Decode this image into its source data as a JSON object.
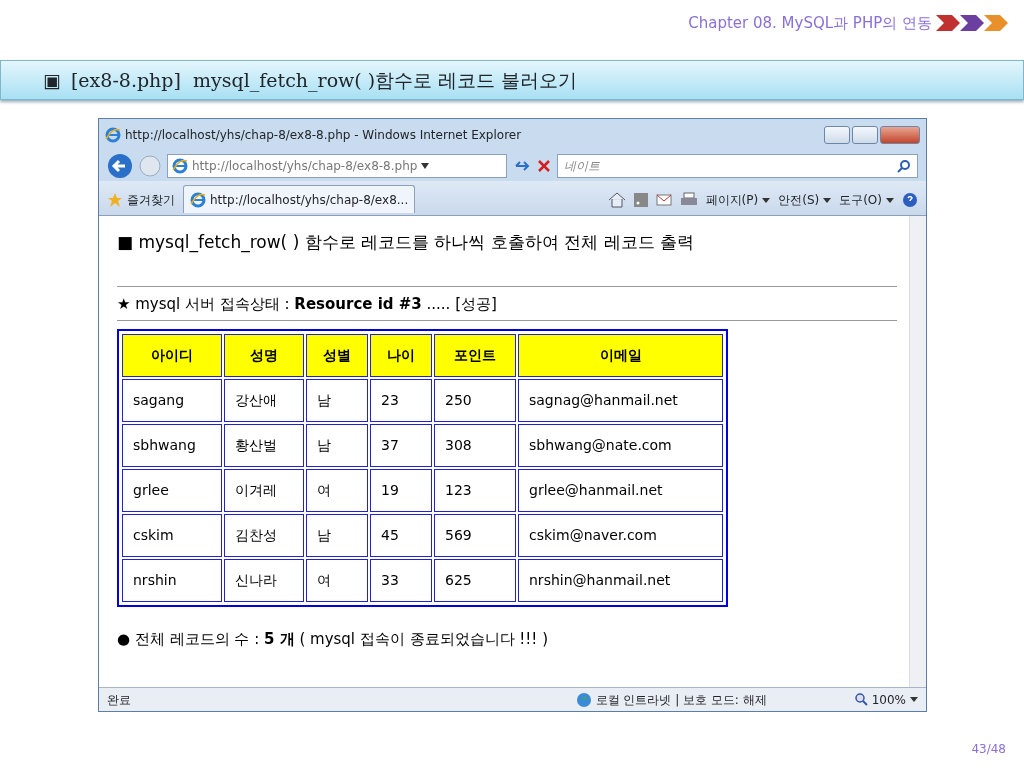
{
  "slide": {
    "chapter": "Chapter 08. MySQL과 PHP의 연동",
    "title_marker": "▣",
    "title": "[ex8-8.php]  mysql_fetch_row( )함수로 레코드 불러오기",
    "page_number": "43/48"
  },
  "browser": {
    "window_title": "http://localhost/yhs/chap-8/ex8-8.php - Windows Internet Explorer",
    "address": "http://localhost/yhs/chap-8/ex8-8.php",
    "search": {
      "placeholder": "네이트"
    },
    "favorites": "즐겨찾기",
    "tab": "http://localhost/yhs/chap-8/ex8...",
    "menus": [
      "페이지(P)",
      "안전(S)",
      "도구(O)"
    ],
    "status": "완료",
    "zone": "로컬 인트라넷 | 보호 모드: 해제",
    "zoom": "100%"
  },
  "page": {
    "heading": "■ mysql_fetch_row( ) 함수로 레코드를 하나씩 호출하여 전체 레코드 출력",
    "connection": "★ mysql 서버 접속상태 : **Resource id #3** ..... [성공]",
    "table": {
      "columns": [
        "아이디",
        "성명",
        "성별",
        "나이",
        "포인트",
        "이메일"
      ],
      "rows": [
        [
          "sagang",
          "강산애",
          "남",
          "23",
          "250",
          "sagnag@hanmail.net"
        ],
        [
          "sbhwang",
          "황산벌",
          "남",
          "37",
          "308",
          "sbhwang@nate.com"
        ],
        [
          "grlee",
          "이겨레",
          "여",
          "19",
          "123",
          "grlee@hanmail.net"
        ],
        [
          "cskim",
          "김찬성",
          "남",
          "45",
          "569",
          "cskim@naver.com"
        ],
        [
          "nrshin",
          "신나라",
          "여",
          "33",
          "625",
          "nrshin@hanmail.net"
        ]
      ]
    },
    "summary": "● 전체 레코드의 수 : **5 개** ( mysql 접속이 종료되었습니다 !!! )"
  }
}
